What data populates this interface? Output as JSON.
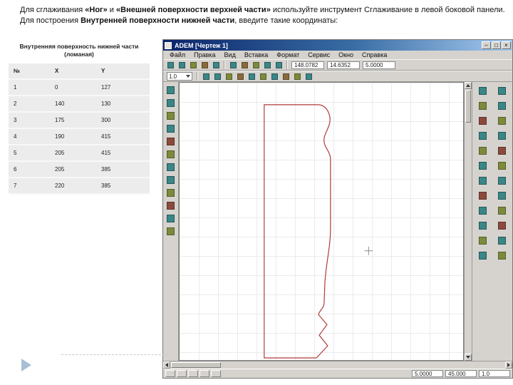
{
  "intro": {
    "line1": [
      {
        "t": "Для сглаживания ",
        "b": 0
      },
      {
        "t": "«Ног»",
        "b": 1
      },
      {
        "t": " и ",
        "b": 0
      },
      {
        "t": "«Внешней поверхности верхней части»",
        "b": 1
      },
      {
        "t": " используйте инструмент Сглаживание в левой боковой панели.",
        "b": 0
      }
    ],
    "line2": [
      {
        "t": "Для построения ",
        "b": 0
      },
      {
        "t": "Внутренней поверхности нижней части",
        "b": 1
      },
      {
        "t": ", введите такие координаты:",
        "b": 0
      }
    ]
  },
  "table": {
    "title": "Внутренняя поверхность нижней части (ломаная)",
    "headers": [
      "№",
      "X",
      "Y"
    ],
    "rows": [
      [
        "1",
        "0",
        "127"
      ],
      [
        "2",
        "140",
        "130"
      ],
      [
        "3",
        "175",
        "300"
      ],
      [
        "4",
        "190",
        "415"
      ],
      [
        "5",
        "205",
        "415"
      ],
      [
        "6",
        "205",
        "385"
      ],
      [
        "7",
        "220",
        "385"
      ]
    ]
  },
  "cad": {
    "title": "ADEM [Чертеж 1]",
    "window_buttons": [
      "minimize",
      "maximize",
      "close"
    ],
    "menu": [
      "Файл",
      "Правка",
      "Вид",
      "Вставка",
      "Формат",
      "Сервис",
      "Окно",
      "Справка"
    ],
    "toolbar_main": {
      "icons": [
        "new-file",
        "open-file",
        "save",
        "print",
        "print-preview",
        "cut",
        "copy",
        "paste",
        "undo",
        "redo"
      ],
      "fields": [
        "148.0782",
        "14.6352",
        "5.0000"
      ]
    },
    "toolbar_view": {
      "zoom_value": "1.0",
      "icons": [
        "zoom-in",
        "zoom-out",
        "zoom-all",
        "pan",
        "refresh",
        "grid-toggle",
        "ortho-toggle",
        "layers",
        "measure",
        "help"
      ]
    },
    "left_panel_icons": [
      "select",
      "point",
      "line",
      "polyline",
      "arc",
      "circle",
      "spline",
      "rectangle",
      "text",
      "hatch",
      "dimension",
      "smooth"
    ],
    "right_panel_icons": [
      "move",
      "copy-entity",
      "rotate",
      "mirror",
      "scale",
      "array",
      "trim",
      "extend",
      "fillet",
      "chamfer",
      "offset",
      "erase",
      "explode",
      "join",
      "group",
      "ungroup",
      "properties",
      "layer-manager",
      "snap",
      "ortho",
      "measure-distance",
      "info",
      "undo-edit",
      "redo-edit"
    ],
    "status": {
      "buttons": [
        "snap-toggle",
        "grid-toggle",
        "ortho-toggle",
        "layer-toggle",
        "coords-toggle"
      ],
      "fields": [
        "5.0000",
        "45.000",
        "1.0"
      ]
    }
  },
  "colors": {
    "accent_red": "#b03a3a",
    "titlebar_blue": "#0a246a",
    "chrome_gray": "#d6d3ce",
    "icon_teal": "#3b8686"
  }
}
